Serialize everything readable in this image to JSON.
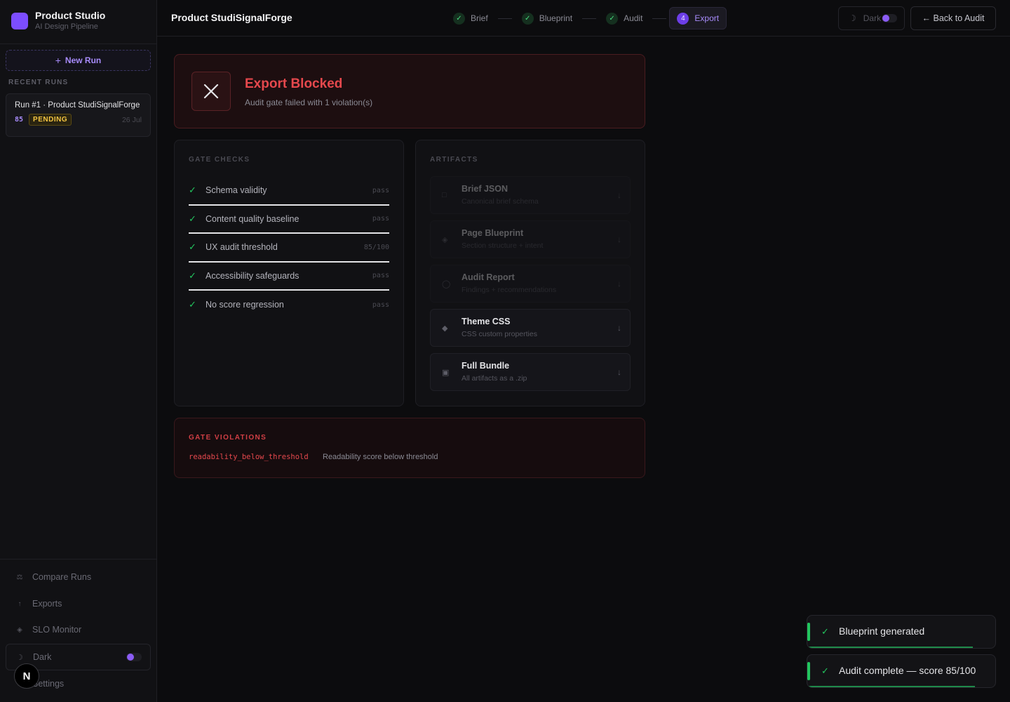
{
  "sidebar": {
    "brand_title": "Product Studio",
    "brand_subtitle": "AI Design Pipeline",
    "new_run_label": "New Run",
    "recent_runs_label": "RECENT RUNS",
    "runs": [
      {
        "title": "Run #1 · Product StudiSignalForge",
        "score": "85",
        "status": "PENDING",
        "date": "26 Jul"
      }
    ],
    "nav": [
      {
        "label": "Compare Runs",
        "icon": "scale-icon"
      },
      {
        "label": "Exports",
        "icon": "arrow-up-icon"
      },
      {
        "label": "SLO Monitor",
        "icon": "diamond-icon"
      }
    ],
    "theme_label": "Dark",
    "settings_label": "Settings"
  },
  "header": {
    "project_title": "Product StudiSignalForge",
    "steps": [
      {
        "label": "Brief",
        "state": "done",
        "marker": "✓"
      },
      {
        "label": "Blueprint",
        "state": "done",
        "marker": "✓"
      },
      {
        "label": "Audit",
        "state": "done",
        "marker": "✓"
      },
      {
        "label": "Export",
        "state": "active",
        "marker": "4"
      }
    ],
    "theme_label": "Dark",
    "back_label": "← Back to Audit"
  },
  "blocked": {
    "title": "Export Blocked",
    "subtitle": "Audit gate failed with 1 violation(s)"
  },
  "gate_checks": {
    "label": "GATE CHECKS",
    "items": [
      {
        "name": "Schema validity",
        "status": "pass"
      },
      {
        "name": "Content quality baseline",
        "status": "pass"
      },
      {
        "name": "UX audit threshold",
        "status": "85/100"
      },
      {
        "name": "Accessibility safeguards",
        "status": "pass"
      },
      {
        "name": "No score regression",
        "status": "pass"
      }
    ]
  },
  "artifacts": {
    "label": "ARTIFACTS",
    "items": [
      {
        "name": "Brief JSON",
        "desc": "Canonical brief schema",
        "icon": "□",
        "enabled": false
      },
      {
        "name": "Page Blueprint",
        "desc": "Section structure + intent",
        "icon": "◈",
        "enabled": false
      },
      {
        "name": "Audit Report",
        "desc": "Findings + recommendations",
        "icon": "◯",
        "enabled": false
      },
      {
        "name": "Theme CSS",
        "desc": "CSS custom properties",
        "icon": "◆",
        "enabled": true
      },
      {
        "name": "Full Bundle",
        "desc": "All artifacts as a .zip",
        "icon": "▣",
        "enabled": true
      }
    ]
  },
  "violations": {
    "label": "GATE VIOLATIONS",
    "items": [
      {
        "code": "readability_below_threshold",
        "desc": "Readability score below threshold"
      }
    ]
  },
  "toasts": [
    {
      "message": "Blueprint generated",
      "progress": 0.88
    },
    {
      "message": "Audit complete — score 85/100",
      "progress": 0.89
    }
  ],
  "colors": {
    "accent": "#8b5cf6",
    "danger": "#e5484d",
    "success": "#22c55e",
    "warning": "#f5c542"
  }
}
